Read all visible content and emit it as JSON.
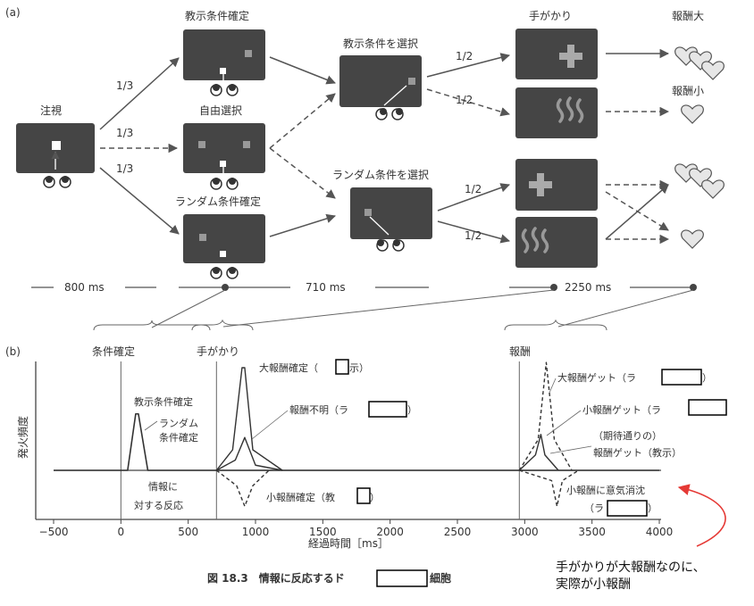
{
  "panel_a": {
    "label": "(a)",
    "fixation_label": "注視",
    "instructed_confirm_label": "教示条件確定",
    "free_choice_label": "自由選択",
    "random_confirm_label": "ランダム条件確定",
    "select_instructed_label": "教示条件を選択",
    "select_random_label": "ランダム条件を選択",
    "cue_label": "手がかり",
    "reward_big_label": "報酬大",
    "reward_small_label": "報酬小",
    "prob_third": "1/3",
    "prob_half": "1/2",
    "time_800": "800 ms",
    "time_710": "710 ms",
    "time_2250": "2250 ms"
  },
  "panel_b": {
    "label": "(b)",
    "event_condition": "条件確定",
    "event_cue": "手がかり",
    "event_reward": "報酬",
    "ylabel": "発火頻度",
    "xlabel": "経過時間［ms］",
    "annot_instructed_confirm": "教示条件確定",
    "annot_random_confirm_1": "ランダム",
    "annot_random_confirm_2": "条件確定",
    "annot_info_1": "情報に",
    "annot_info_2": "対する反応",
    "annot_big_confirm_pre": "大報酬確定（",
    "annot_big_confirm_post": "示）",
    "annot_unknown": "報酬不明（ラ",
    "annot_unknown_post": "）",
    "annot_small_confirm": "小報酬確定（教",
    "annot_small_confirm_post": "）",
    "annot_big_get": "大報酬ゲット（ラ",
    "annot_big_get_post": "）",
    "annot_small_get": "小報酬ゲット（ラ",
    "annot_expected_1": "（期待通りの）",
    "annot_expected_2": "報酬ゲット（教示）",
    "annot_vanish_1": "小報酬に意気消沈",
    "annot_vanish_2": "（ラ",
    "annot_vanish_post": "）"
  },
  "note": {
    "line1": "手がかりが大報酬なのに、",
    "line2": "実際が小報酬",
    "color": "#e53935"
  },
  "caption": {
    "prefix": "図 18.3　情報に反応するド",
    "suffix": "細胞"
  },
  "chart_data": {
    "type": "line",
    "xlabel": "経過時間［ms］",
    "ylabel": "発火頻度",
    "xlim": [
      -500,
      4000
    ],
    "xticks": [
      "−500",
      "0",
      "500",
      "1000",
      "1500",
      "2000",
      "2500",
      "3000",
      "3500",
      "4000"
    ],
    "event_lines_ms": [
      0,
      710,
      2960
    ],
    "series": [
      {
        "name": "教示条件確定",
        "x": [
          -500,
          50,
          110,
          130,
          200,
          500,
          4000
        ],
        "y": [
          0,
          0,
          0.55,
          0.55,
          0,
          0,
          0
        ]
      },
      {
        "name": "大報酬確定（□示）",
        "x": [
          710,
          830,
          900,
          920,
          980,
          1200
        ],
        "y": [
          0,
          0.2,
          1.0,
          1.0,
          0.2,
          0
        ]
      },
      {
        "name": "報酬不明（ラ□）",
        "x": [
          710,
          850,
          920,
          1000,
          1200
        ],
        "y": [
          0,
          0.1,
          0.32,
          0.05,
          0
        ]
      },
      {
        "name": "小報酬確定（教□）",
        "x": [
          710,
          860,
          920,
          980,
          1100
        ],
        "y": [
          0,
          -0.15,
          -0.35,
          -0.15,
          0
        ]
      },
      {
        "name": "大報酬ゲット（ラ□）",
        "x": [
          2960,
          3100,
          3160,
          3220,
          3350
        ],
        "y": [
          0,
          0.3,
          1.05,
          0.3,
          0
        ]
      },
      {
        "name": "小報酬ゲット（ラ□）",
        "x": [
          2960,
          3080,
          3120,
          3150,
          3250
        ],
        "y": [
          0,
          0.15,
          0.35,
          0.15,
          0
        ]
      },
      {
        "name": "小報酬に意気消沈（ラ□）",
        "x": [
          2960,
          3200,
          3240,
          3280,
          3400
        ],
        "y": [
          0,
          -0.1,
          -0.35,
          -0.1,
          0
        ]
      }
    ]
  }
}
